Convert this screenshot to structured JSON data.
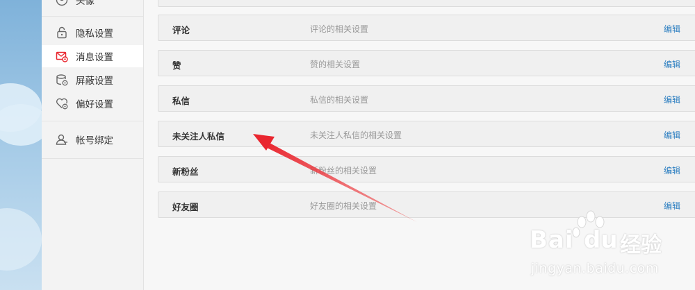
{
  "sidebar": {
    "items": [
      {
        "label": "头像",
        "icon": "avatar-icon",
        "active": false
      },
      {
        "label": "隐私设置",
        "icon": "lock-icon",
        "active": false
      },
      {
        "label": "消息设置",
        "icon": "message-settings-icon",
        "active": true
      },
      {
        "label": "屏蔽设置",
        "icon": "block-settings-icon",
        "active": false
      },
      {
        "label": "偏好设置",
        "icon": "preference-settings-icon",
        "active": false
      },
      {
        "label": "帐号绑定",
        "icon": "user-bind-icon",
        "active": false
      }
    ]
  },
  "settings": {
    "rows": [
      {
        "name": "",
        "desc": "",
        "edit": ""
      },
      {
        "name": "评论",
        "desc": "评论的相关设置",
        "edit": "编辑"
      },
      {
        "name": "赞",
        "desc": "赞的相关设置",
        "edit": "编辑"
      },
      {
        "name": "私信",
        "desc": "私信的相关设置",
        "edit": "编辑"
      },
      {
        "name": "未关注人私信",
        "desc": "未关注人私信的相关设置",
        "edit": "编辑"
      },
      {
        "name": "新粉丝",
        "desc": "新粉丝的相关设置",
        "edit": "编辑"
      },
      {
        "name": "好友圈",
        "desc": "好友圈的相关设置",
        "edit": "编辑"
      }
    ]
  },
  "watermark": {
    "brand": "Bai",
    "brand2": "du",
    "product": "经验",
    "url": "jingyan.baidu.com"
  },
  "colors": {
    "accent_red": "#e9262f",
    "link_blue": "#2d7fc1"
  }
}
